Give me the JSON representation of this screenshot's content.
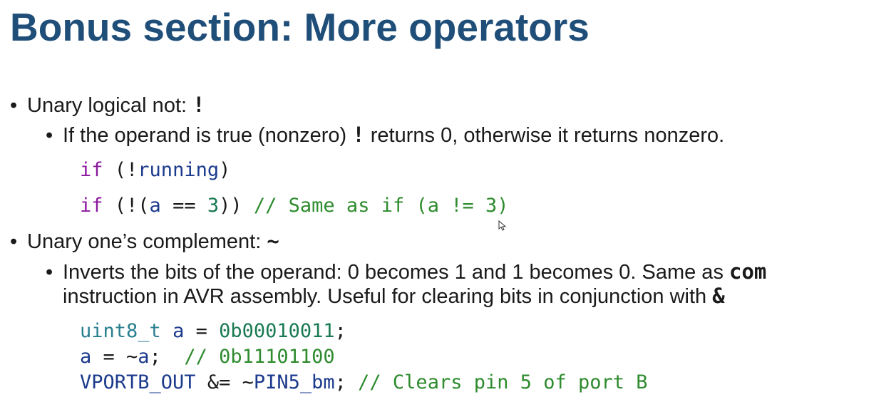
{
  "title": "Bonus section: More operators",
  "bullets": [
    {
      "text": "Unary logical not: ",
      "operator": "!",
      "sub": {
        "pre": "If the operand is true (nonzero) ",
        "operator": "!",
        "post": " returns 0, otherwise it returns nonzero."
      },
      "code": [
        {
          "kw": "if",
          "p1": " (!",
          "id": "running",
          "p2": ")"
        },
        {
          "kw": "if",
          "p1": " (!(",
          "id": "a",
          "p2": " == ",
          "num": "3",
          "p3": ")) ",
          "comment": "// Same as if (a != 3)"
        }
      ]
    },
    {
      "text": "Unary one’s complement: ",
      "operator": "~",
      "sub": {
        "line1_pre": "Inverts the bits of the operand: 0 becomes 1 and 1 becomes 0. Same as ",
        "line1_code": "com",
        "line2_pre": "instruction in AVR assembly. Useful for clearing bits in conjunction with ",
        "line2_code": "&"
      },
      "code": [
        {
          "type": "uint8_t",
          "p1": " ",
          "id": "a",
          "p2": " = ",
          "num": "0b00010011",
          "p3": ";"
        },
        {
          "id": "a",
          "p1": " = ~",
          "id2": "a",
          "p2": ";  ",
          "comment": "// 0b11101100"
        },
        {
          "id": "VPORTB_OUT",
          "p1": " &= ~",
          "id2": "PIN5_bm",
          "p2": "; ",
          "comment": "// Clears pin 5 of port B"
        }
      ]
    }
  ],
  "icons": {
    "bullet": "bullet-dot",
    "cursor": "mouse-pointer-icon"
  },
  "colors": {
    "title": "#1f4e79",
    "keyword": "#8b1a9e",
    "identifier": "#1b3a8c",
    "number": "#197a52",
    "comment": "#2e8b2e",
    "type": "#2a7f8f"
  }
}
